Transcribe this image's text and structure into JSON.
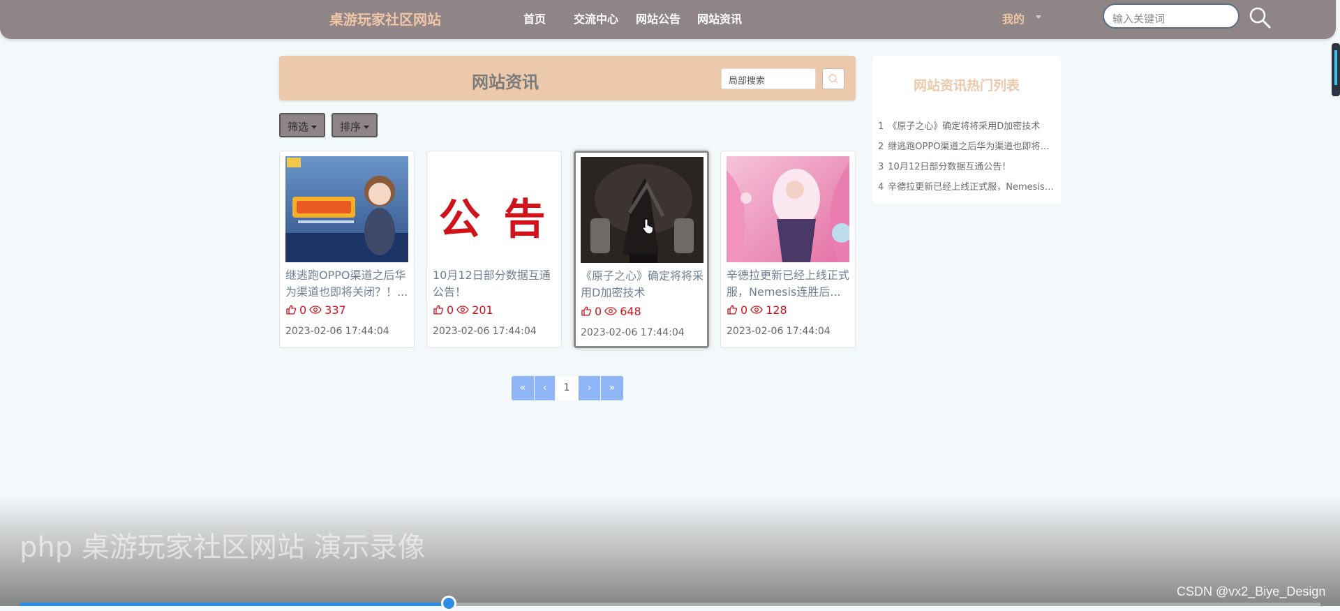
{
  "nav": {
    "site_title": "桌游玩家社区网站",
    "links": [
      "首页",
      "交流中心",
      "网站公告",
      "网站资讯"
    ],
    "user_menu": "我的",
    "search_placeholder": "输入关键词"
  },
  "page": {
    "title": "网站资讯",
    "local_search_placeholder": "局部搜索",
    "filter_label": "筛选",
    "sort_label": "排序"
  },
  "cards": [
    {
      "title": "继逃跑OPPO渠道之后华为渠道也即将关闭？！...",
      "likes": "0",
      "views": "337",
      "date": "2023-02-06 17:44:04",
      "image": "official-announcement-art"
    },
    {
      "title": "10月12日部分数据互通公告！",
      "likes": "0",
      "views": "201",
      "date": "2023-02-06 17:44:04",
      "image": "announcement-text",
      "image_text": "公 告"
    },
    {
      "title": "《原子之心》确定将将采用D加密技术",
      "likes": "0",
      "views": "648",
      "date": "2023-02-06 17:44:04",
      "image": "dark-robot-hands"
    },
    {
      "title": "辛德拉更新已经上线正式服，Nemesis连胜后...",
      "likes": "0",
      "views": "128",
      "date": "2023-02-06 17:44:04",
      "image": "pink-fantasy-character"
    }
  ],
  "pagination": {
    "first": "«",
    "prev": "‹",
    "current": "1",
    "next": "›",
    "last": "»"
  },
  "hot_list": {
    "title": "网站资讯热门列表",
    "items": [
      {
        "num": "1",
        "text": "《原子之心》确定将将采用D加密技术"
      },
      {
        "num": "2",
        "text": "继逃跑OPPO渠道之后华为渠道也即将关闭？！"
      },
      {
        "num": "3",
        "text": "10月12日部分数据互通公告！"
      },
      {
        "num": "4",
        "text": "辛德拉更新已经上线正式服，Nemesis连胜后..."
      }
    ]
  },
  "video": {
    "overlay_title": "php 桌游玩家社区网站 演示录像",
    "progress": 0.33,
    "watermark": "CSDN @vx2_Biye_Design"
  },
  "colors": {
    "nav_bg": "#8f8587",
    "accent_peach": "#ecc9ab",
    "stat_red": "#d0121b",
    "pager_blue": "#8fb5f6"
  }
}
